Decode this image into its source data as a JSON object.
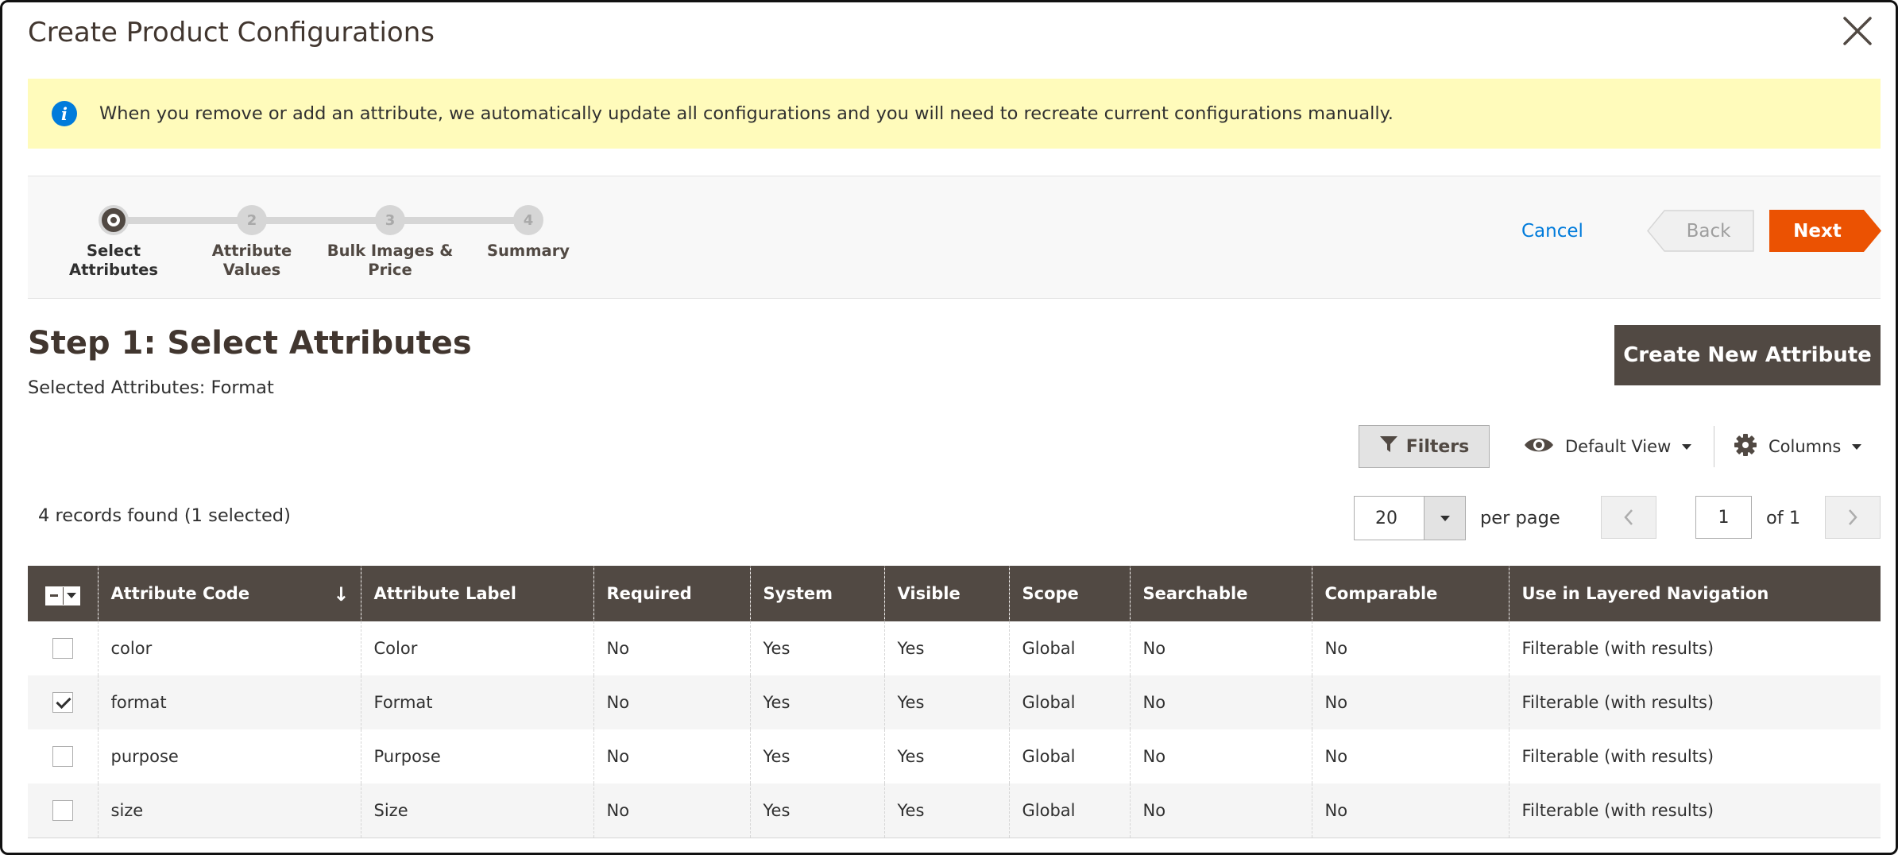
{
  "modal": {
    "title": "Create Product Configurations"
  },
  "notice": {
    "message": "When you remove or add an attribute, we automatically update all configurations and you will need to recreate current configurations manually."
  },
  "wizard": {
    "steps": [
      {
        "number": "",
        "label_line1": "Select",
        "label_line2": "Attributes",
        "state": "active"
      },
      {
        "number": "2",
        "label_line1": "Attribute",
        "label_line2": "Values",
        "state": "pending"
      },
      {
        "number": "3",
        "label_line1": "Bulk Images &",
        "label_line2": "Price",
        "state": "pending"
      },
      {
        "number": "4",
        "label_line1": "Summary",
        "label_line2": "",
        "state": "pending"
      }
    ],
    "cancel_label": "Cancel",
    "back_label": "Back",
    "next_label": "Next"
  },
  "step": {
    "title": "Step 1: Select Attributes",
    "selected_attributes": "Selected Attributes: Format",
    "create_button_label": "Create New Attribute"
  },
  "toolbar": {
    "filters_label": "Filters",
    "view_label": "Default View",
    "columns_label": "Columns",
    "records_found": "4 records found (1 selected)",
    "per_page_value": "20",
    "per_page_label": "per page",
    "current_page": "1",
    "of_pages": "of 1"
  },
  "grid": {
    "columns": [
      "Attribute Code",
      "Attribute Label",
      "Required",
      "System",
      "Visible",
      "Scope",
      "Searchable",
      "Comparable",
      "Use in Layered Navigation"
    ],
    "rows": [
      {
        "checked": false,
        "cells": [
          "color",
          "Color",
          "No",
          "Yes",
          "Yes",
          "Global",
          "No",
          "No",
          "Filterable (with results)"
        ]
      },
      {
        "checked": true,
        "cells": [
          "format",
          "Format",
          "No",
          "Yes",
          "Yes",
          "Global",
          "No",
          "No",
          "Filterable (with results)"
        ]
      },
      {
        "checked": false,
        "cells": [
          "purpose",
          "Purpose",
          "No",
          "Yes",
          "Yes",
          "Global",
          "No",
          "No",
          "Filterable (with results)"
        ]
      },
      {
        "checked": false,
        "cells": [
          "size",
          "Size",
          "No",
          "Yes",
          "Yes",
          "Global",
          "No",
          "No",
          "Filterable (with results)"
        ]
      }
    ]
  },
  "colors": {
    "header_bg": "#514943",
    "notice_bg": "#fffbbb",
    "next_bg": "#eb5202",
    "link": "#007bdb",
    "info_icon": "#007bdb"
  },
  "icons": {
    "close": "close-icon",
    "info": "info-icon",
    "filter": "filter-icon",
    "eye": "eye-icon",
    "gear": "gear-icon",
    "sort": "sort-down-icon"
  }
}
